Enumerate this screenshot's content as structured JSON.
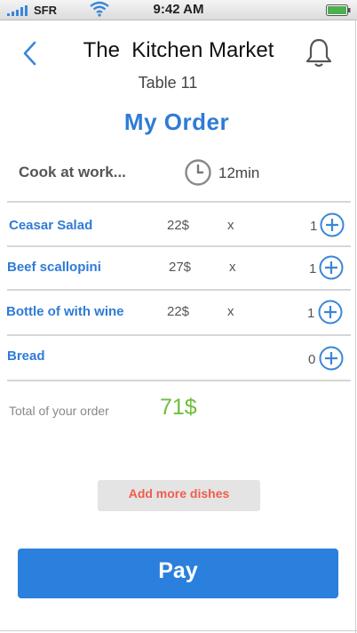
{
  "status_bar": {
    "carrier": "SFR",
    "time": "9:42 AM",
    "signal_icon": "signal-bars-icon",
    "wifi_icon": "wifi-icon",
    "battery_icon": "battery-icon"
  },
  "header": {
    "title": "The  Kitchen Market",
    "subtitle": "Table 11",
    "back_icon": "chevron-left-icon",
    "bell_icon": "bell-icon"
  },
  "order": {
    "title": "My Order",
    "status_text": "Cook at work...",
    "clock_icon": "clock-icon",
    "eta": "12min"
  },
  "items": [
    {
      "name": "Ceasar Salad",
      "price": "22$",
      "times": "x",
      "qty": "1"
    },
    {
      "name": "Beef scallopini",
      "price": "27$",
      "times": "x",
      "qty": "1"
    },
    {
      "name": "Bottle of with wine",
      "price": "22$",
      "times": "x",
      "qty": "1"
    },
    {
      "name": "Bread",
      "price": "",
      "times": "",
      "qty": "0"
    }
  ],
  "total": {
    "label": "Total of your order",
    "value": "71$"
  },
  "actions": {
    "add_more": "Add more dishes",
    "pay": "Pay"
  },
  "colors": {
    "accent_blue": "#2f7bd6",
    "pay_button": "#2b7fdd",
    "total_green": "#6cbf3c",
    "add_more_red": "#f25c4e"
  }
}
